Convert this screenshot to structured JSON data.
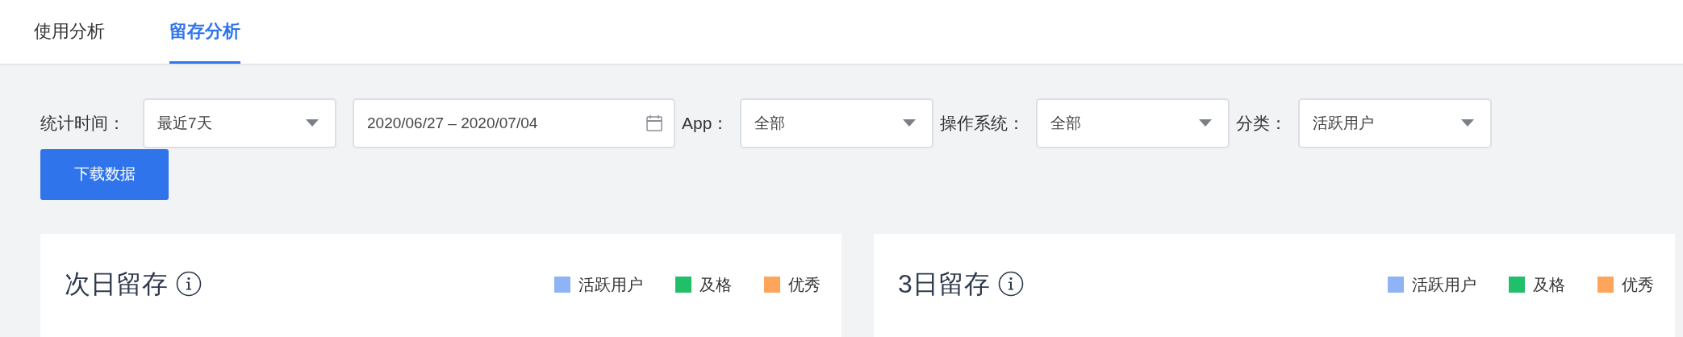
{
  "tabs": [
    {
      "label": "使用分析",
      "selected": false
    },
    {
      "label": "留存分析",
      "selected": true
    }
  ],
  "filters": [
    {
      "label": "统计时间：",
      "controls": [
        {
          "kind": "select",
          "value": "最近7天"
        },
        {
          "kind": "date",
          "value": "2020/06/27 – 2020/07/04"
        }
      ]
    },
    {
      "label": "App：",
      "controls": [
        {
          "kind": "select",
          "value": "全部"
        }
      ]
    },
    {
      "label": "操作系统：",
      "controls": [
        {
          "kind": "select",
          "value": "全部"
        }
      ]
    },
    {
      "label": "分类：",
      "controls": [
        {
          "kind": "select",
          "value": "活跃用户"
        }
      ]
    }
  ],
  "download_button": "下载数据",
  "cards": [
    {
      "title": "次日留存",
      "legend": [
        {
          "label": "活跃用户",
          "color": "#8fb4f5"
        },
        {
          "label": "及格",
          "color": "#22bf6a"
        },
        {
          "label": "优秀",
          "color": "#fda65b"
        }
      ]
    },
    {
      "title": "3日留存",
      "legend": [
        {
          "label": "活跃用户",
          "color": "#8fb4f5"
        },
        {
          "label": "及格",
          "color": "#22bf6a"
        },
        {
          "label": "优秀",
          "color": "#fda65b"
        }
      ]
    }
  ]
}
